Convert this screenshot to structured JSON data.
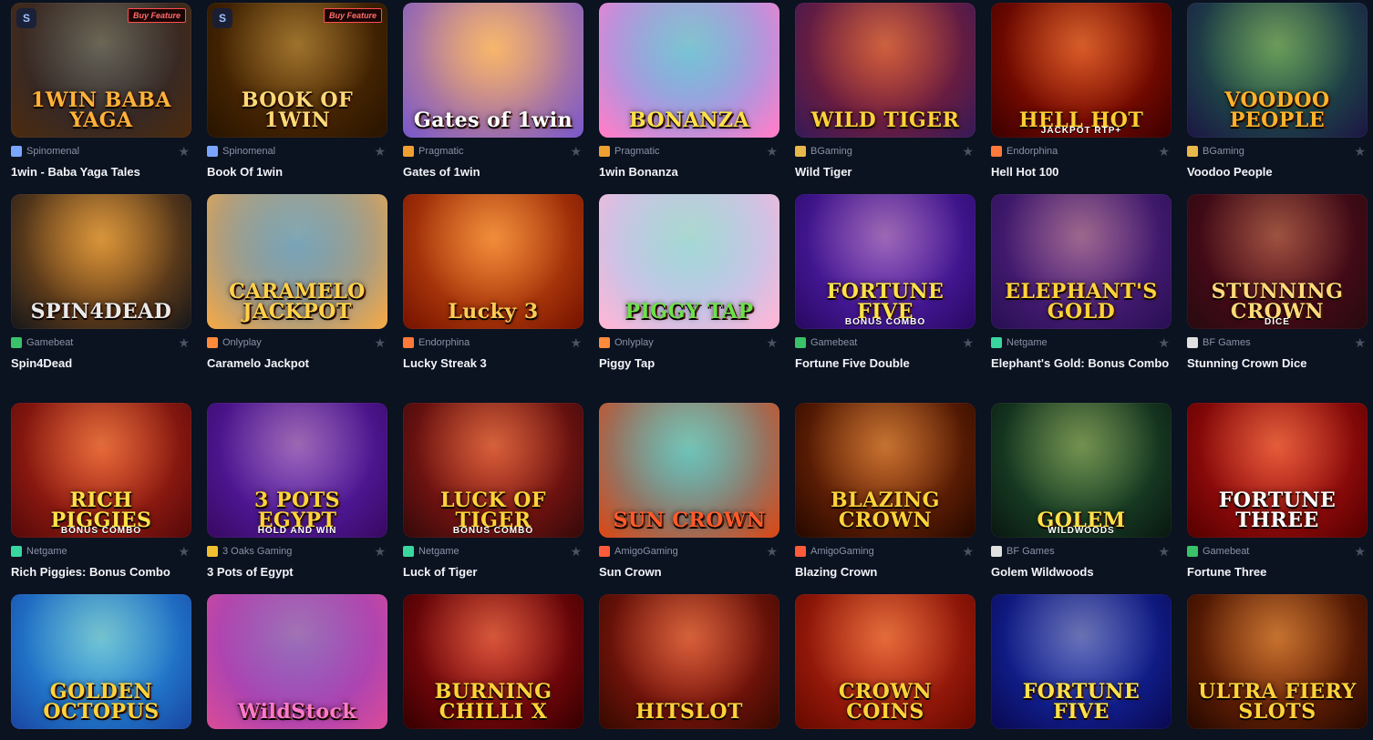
{
  "games": [
    {
      "name": "1win - Baba Yaga Tales",
      "provider": "Spinomenal",
      "prov_color": "#7aa6ff",
      "art": "1WIN BABA YAGA",
      "bg": "#1b2744",
      "bg2": "#4a2a10",
      "badge": "S",
      "buy": "Buy Feature",
      "art_color": "#ffb23a",
      "row": 0
    },
    {
      "name": "Book Of 1win",
      "provider": "Spinomenal",
      "prov_color": "#7aa6ff",
      "art": "BOOK OF 1WIN",
      "bg": "#6b3a05",
      "bg2": "#2a1500",
      "badge": "S",
      "buy": "Buy Feature",
      "art_color": "#ffd977",
      "row": 0
    },
    {
      "name": "Gates of 1win",
      "provider": "Pragmatic",
      "prov_color": "#f0a030",
      "art": "Gates of 1win",
      "bg": "#f3a266",
      "bg2": "#7c5ac8",
      "badge": "",
      "buy": "",
      "art_color": "#ffffff",
      "row": 0
    },
    {
      "name": "1win Bonanza",
      "provider": "Pragmatic",
      "prov_color": "#f0a030",
      "art": "BONANZA",
      "bg": "#39b7ff",
      "bg2": "#ff7ec8",
      "badge": "",
      "buy": "",
      "art_color": "#ffe14a",
      "row": 0
    },
    {
      "name": "Wild Tiger",
      "provider": "BGaming",
      "prov_color": "#e9b84a",
      "art": "WILD TIGER",
      "bg": "#b32020",
      "bg2": "#3a1a55",
      "badge": "",
      "buy": "",
      "art_color": "#ffd23a",
      "row": 0
    },
    {
      "name": "Hell Hot 100",
      "provider": "Endorphina",
      "prov_color": "#ff7a3a",
      "art": "HELL HOT",
      "bg": "#c11a00",
      "bg2": "#400000",
      "badge": "",
      "buy": "",
      "art_color": "#ffcc33",
      "row": 0
    },
    {
      "name": "Voodoo People",
      "provider": "BGaming",
      "prov_color": "#e9b84a",
      "art": "VOODOO PEOPLE",
      "bg": "#1f7a4a",
      "bg2": "#1c1a44",
      "badge": "",
      "buy": "",
      "art_color": "#ffb22a",
      "row": 0
    },
    {
      "name": "Spin4Dead",
      "provider": "Gamebeat",
      "prov_color": "#39c26a",
      "art": "SPIN4DEAD",
      "bg": "#c46f1a",
      "bg2": "#1c1a1a",
      "badge": "",
      "buy": "",
      "art_color": "#e9e9e9",
      "row": 1
    },
    {
      "name": "Caramelo Jackpot",
      "provider": "Onlyplay",
      "prov_color": "#ff8a3a",
      "art": "CARAMELO JACKPOT",
      "bg": "#3a8ad6",
      "bg2": "#f0a84a",
      "badge": "",
      "buy": "",
      "art_color": "#ffd14a",
      "row": 1
    },
    {
      "name": "Lucky Streak 3",
      "provider": "Endorphina",
      "prov_color": "#ff7a3a",
      "art": "Lucky 3",
      "bg": "#e9641a",
      "bg2": "#7a1500",
      "badge": "",
      "buy": "",
      "art_color": "#ffcc55",
      "row": 1
    },
    {
      "name": "Piggy Tap",
      "provider": "Onlyplay",
      "prov_color": "#ff8a3a",
      "art": "PIGGY TAP",
      "bg": "#7ad6ff",
      "bg2": "#ffb6d6",
      "badge": "",
      "buy": "",
      "art_color": "#6ee04a",
      "row": 1
    },
    {
      "name": "Fortune Five Double",
      "provider": "Gamebeat",
      "prov_color": "#39c26a",
      "art": "FORTUNE FIVE",
      "bg": "#6a2ad6",
      "bg2": "#2a0a66",
      "badge": "",
      "buy": "",
      "art_color": "#ffe14a",
      "row": 1
    },
    {
      "name": "Elephant's Gold: Bonus Combo",
      "provider": "Netgame",
      "prov_color": "#3ad6a0",
      "art": "ELEPHANT'S GOLD",
      "bg": "#6a2a9a",
      "bg2": "#2a1055",
      "badge": "",
      "buy": "",
      "art_color": "#ffd23a",
      "row": 1
    },
    {
      "name": "Stunning Crown Dice",
      "provider": "BF Games",
      "prov_color": "#e0e0e0",
      "art": "STUNNING CROWN",
      "bg": "#6a0a22",
      "bg2": "#2a0a10",
      "badge": "",
      "buy": "",
      "art_color": "#ffd97a",
      "row": 1
    },
    {
      "name": "Rich Piggies: Bonus Combo",
      "provider": "Netgame",
      "prov_color": "#3ad6a0",
      "art": "RICH PIGGIES",
      "bg": "#d6301a",
      "bg2": "#5a0a0a",
      "badge": "",
      "buy": "",
      "art_color": "#ffe14a",
      "row": 2
    },
    {
      "name": "3 Pots of Egypt",
      "provider": "3 Oaks Gaming",
      "prov_color": "#f0c030",
      "art": "3 POTS EGYPT",
      "bg": "#6a2ad6",
      "bg2": "#3a0a66",
      "badge": "",
      "buy": "",
      "art_color": "#ffd23a",
      "row": 2
    },
    {
      "name": "Luck of Tiger",
      "provider": "Netgame",
      "prov_color": "#3ad6a0",
      "art": "LUCK OF TIGER",
      "bg": "#c1201a",
      "bg2": "#3a0a0a",
      "badge": "",
      "buy": "",
      "art_color": "#ffd23a",
      "row": 2
    },
    {
      "name": "Sun Crown",
      "provider": "AmigoGaming",
      "prov_color": "#ff5a3a",
      "art": "SUN CROWN",
      "bg": "#2ab6d6",
      "bg2": "#d64a1a",
      "badge": "",
      "buy": "",
      "art_color": "#ff5a2a",
      "row": 2
    },
    {
      "name": "Blazing Crown",
      "provider": "AmigoGaming",
      "prov_color": "#ff5a3a",
      "art": "BLAZING CROWN",
      "bg": "#a83a0a",
      "bg2": "#2a0a00",
      "badge": "",
      "buy": "",
      "art_color": "#ffd23a",
      "row": 2
    },
    {
      "name": "Golem Wildwoods",
      "provider": "BF Games",
      "prov_color": "#e0e0e0",
      "art": "GOLEM",
      "bg": "#2a6a3a",
      "bg2": "#0a1a12",
      "badge": "",
      "buy": "",
      "art_color": "#ffe14a",
      "row": 2
    },
    {
      "name": "Fortune Three",
      "provider": "Gamebeat",
      "prov_color": "#39c26a",
      "art": "FORTUNE THREE",
      "bg": "#d61a1a",
      "bg2": "#5a0000",
      "badge": "",
      "buy": "",
      "art_color": "#ffffff",
      "row": 2
    },
    {
      "name": "",
      "provider": "",
      "prov_color": "#888888",
      "art": "GOLDEN OCTOPUS",
      "bg": "#2ab6ff",
      "bg2": "#1a4aa6",
      "badge": "",
      "buy": "",
      "art_color": "#ffd23a",
      "row": 3
    },
    {
      "name": "",
      "provider": "",
      "prov_color": "#888888",
      "art": "WildStock",
      "bg": "#6a3ad6",
      "bg2": "#d64a9a",
      "badge": "",
      "buy": "",
      "art_color": "#ff7ac8",
      "row": 3
    },
    {
      "name": "",
      "provider": "",
      "prov_color": "#888888",
      "art": "BURNING CHILLI X",
      "bg": "#c1101a",
      "bg2": "#3a0000",
      "badge": "",
      "buy": "",
      "art_color": "#ffd23a",
      "row": 3
    },
    {
      "name": "",
      "provider": "",
      "prov_color": "#888888",
      "art": "HITSLOT",
      "bg": "#c1201a",
      "bg2": "#3a0a00",
      "badge": "",
      "buy": "",
      "art_color": "#ffd23a",
      "row": 3
    },
    {
      "name": "",
      "provider": "",
      "prov_color": "#888888",
      "art": "CROWN COINS",
      "bg": "#d6301a",
      "bg2": "#6a0a00",
      "badge": "",
      "buy": "",
      "art_color": "#ffd23a",
      "row": 3
    },
    {
      "name": "",
      "provider": "",
      "prov_color": "#888888",
      "art": "FORTUNE FIVE",
      "bg": "#1a3ad6",
      "bg2": "#0a0a55",
      "badge": "",
      "buy": "",
      "art_color": "#ffe14a",
      "row": 3
    },
    {
      "name": "",
      "provider": "",
      "prov_color": "#888888",
      "art": "ULTRA FIERY SLOTS",
      "bg": "#a83a0a",
      "bg2": "#2a0a00",
      "badge": "",
      "buy": "",
      "art_color": "#ffd23a",
      "row": 3
    }
  ],
  "extras": {
    "card_subtitles": {
      "4": "",
      "5": "JACKPOT RTP+",
      "11": "BONUS COMBO",
      "13": "DICE",
      "14": "BONUS COMBO",
      "15": "HOLD AND WIN",
      "16": "BONUS COMBO",
      "19": "WILDWOODS",
      "24": ""
    }
  }
}
